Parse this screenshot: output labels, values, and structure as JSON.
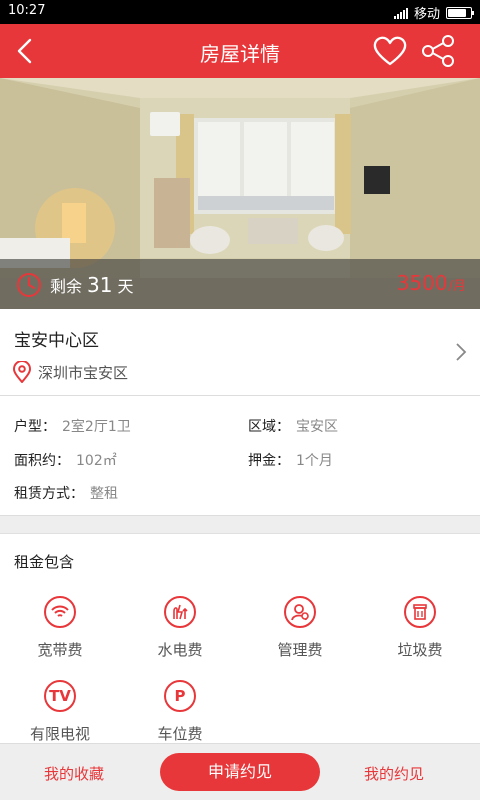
{
  "status_bar": {
    "time": "10:27",
    "carrier": "移动"
  },
  "header": {
    "title": "房屋详情",
    "back_icon": "back-arrow-icon",
    "favorite_icon": "heart-icon",
    "share_icon": "share-icon"
  },
  "photo": {
    "remaining_prefix": "剩余",
    "remaining_days": "31",
    "remaining_suffix": "天",
    "price": "3500",
    "price_unit": "/月"
  },
  "location": {
    "name": "宝安中心区",
    "address": "深圳市宝安区"
  },
  "details": {
    "layout_label": "户型：",
    "layout_value": "2室2厅1卫",
    "district_label": "区域：",
    "district_value": "宝安区",
    "area_label": "面积约：",
    "area_value": "102㎡",
    "deposit_label": "押金：",
    "deposit_value": "1个月",
    "rent_type_label": "租赁方式：",
    "rent_type_value": "整租"
  },
  "included": {
    "title": "租金包含",
    "items": [
      {
        "label": "宽带费",
        "icon": "wifi-icon"
      },
      {
        "label": "水电费",
        "icon": "utilities-icon"
      },
      {
        "label": "管理费",
        "icon": "management-icon"
      },
      {
        "label": "垃圾费",
        "icon": "trash-icon"
      },
      {
        "label": "有限电视",
        "icon": "tv-icon",
        "glyph": "TV"
      },
      {
        "label": "车位费",
        "icon": "parking-icon",
        "glyph": "P"
      }
    ]
  },
  "bottom": {
    "favorites": "我的收藏",
    "apply": "申请约见",
    "appointments": "我的约见"
  },
  "colors": {
    "accent": "#e8373a"
  }
}
